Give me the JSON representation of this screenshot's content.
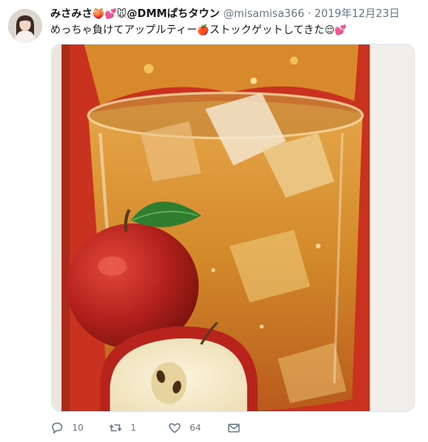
{
  "tweet": {
    "display_name": "みさみさ",
    "name_emojis": "🍑💕🐭",
    "name_suffix": "@DMMぱちタウン",
    "handle": "@misamisa366",
    "separator": "·",
    "date": "2019年12月23日",
    "text_part1": "めっちゃ負けてアップルティー",
    "text_emoji1": "🍎",
    "text_part2": "ストックゲットしてきた",
    "text_emoji2": "😌💕"
  },
  "actions": {
    "reply_count": "10",
    "retweet_count": "1",
    "like_count": "64"
  },
  "icons": {
    "reply": "reply-icon",
    "retweet": "retweet-icon",
    "like": "heart-icon",
    "dm": "envelope-icon"
  },
  "colors": {
    "text": "#14171a",
    "secondary": "#657786",
    "media_red": "#c8321e",
    "tea_amber": "#d49a2a"
  }
}
